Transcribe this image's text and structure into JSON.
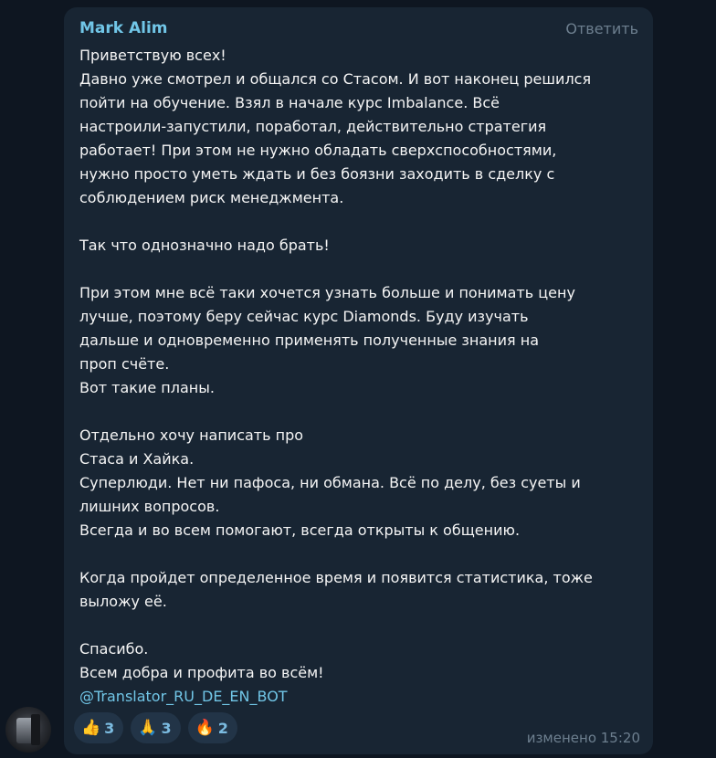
{
  "message": {
    "sender": "Mark Alim",
    "reply_label": "Ответить",
    "lines": [
      "Приветствую всех!",
      "Давно уже смотрел и общался со Стасом. И вот наконец решился",
      "пойти на обучение. Взял в начале курс Imbalance. Всё",
      "настроили-запустили, поработал, действительно стратегия",
      "работает! При этом не нужно обладать сверхспособностями,",
      "нужно просто уметь ждать и без боязни заходить в сделку с",
      "соблюдением риск менеджмента.",
      "",
      "Так что однозначно надо брать!",
      "",
      "При этом мне всё таки хочется узнать больше и понимать цену",
      "лучше, поэтому беру сейчас курс Diamonds. Буду изучать",
      "дальше и одновременно применять полученные знания на",
      "проп счёте.",
      "Вот такие планы.",
      "",
      "Отдельно хочу написать про",
      "Стаса и Хайка.",
      "Суперлюди. Нет ни пафоса, ни обмана. Всё по делу, без суеты и",
      "лишних вопросов.",
      "Всегда и во всем помогают, всегда открыты к общению.",
      "",
      "Когда пройдет определенное время и появится статистика, тоже",
      "выложу её.",
      "",
      "Спасибо.",
      "Всем добра и  профита во всём!"
    ],
    "link": "@Translator_RU_DE_EN_BOT",
    "reactions": [
      {
        "emoji": "👍",
        "icon": "thumbs-up-icon",
        "count": "3"
      },
      {
        "emoji": "🙏",
        "icon": "praying-hands-icon",
        "count": "3"
      },
      {
        "emoji": "🔥",
        "icon": "fire-icon",
        "count": "2"
      }
    ],
    "status": "изменено 15:20"
  },
  "colors": {
    "background": "#0e1621",
    "bubble": "#182533",
    "accent": "#71c6e7",
    "text": "#f5f5f5",
    "muted": "#6d7f8f"
  }
}
